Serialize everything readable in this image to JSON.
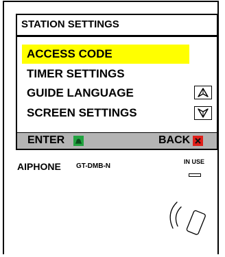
{
  "screen": {
    "title": "STATION SETTINGS",
    "menu": [
      {
        "label": "ACCESS CODE",
        "selected": true
      },
      {
        "label": "TIMER SETTINGS",
        "selected": false
      },
      {
        "label": "GUIDE LANGUAGE",
        "selected": false
      },
      {
        "label": "SCREEN SETTINGS",
        "selected": false
      }
    ],
    "softkeys": {
      "enter_label": "ENTER",
      "back_label": "BACK"
    }
  },
  "device": {
    "brand": "AIPHONE",
    "model": "GT-DMB-N",
    "indicator_label": "IN USE"
  },
  "colors": {
    "selection": "#ffff00",
    "softkey_bar": "#b4b4b4",
    "enter_key": "#22a340",
    "back_key": "#e0201a"
  },
  "icons": [
    "up-arrow-icon",
    "down-arrow-icon",
    "bell-icon",
    "close-icon",
    "nfc-reader-icon"
  ]
}
